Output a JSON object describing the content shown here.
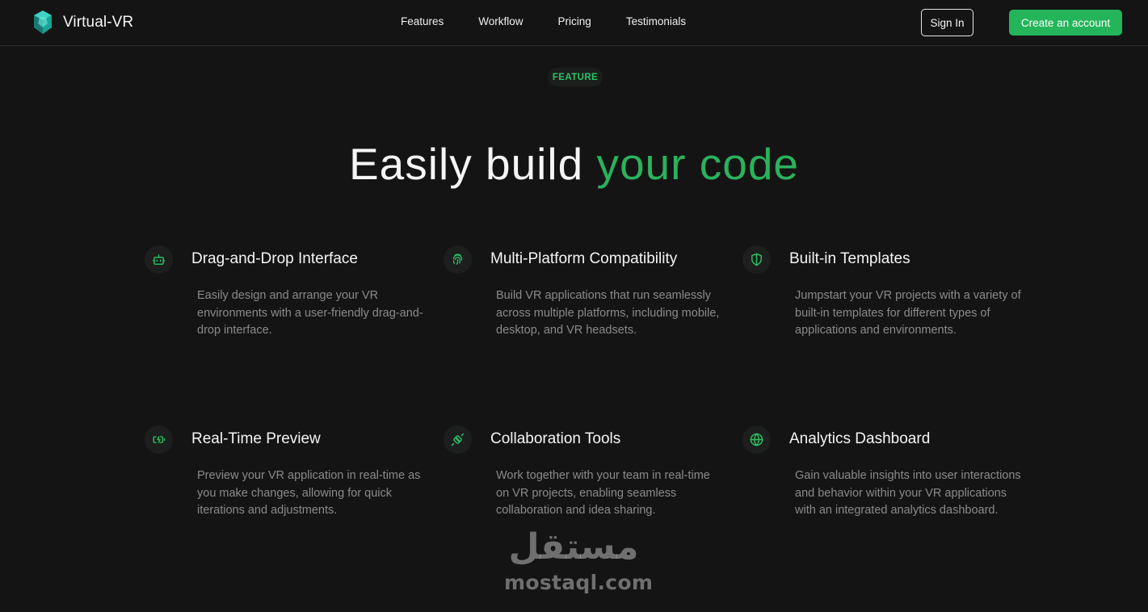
{
  "brand": {
    "name": "Virtual-VR",
    "logo_icon": "vr-gem-logo-icon"
  },
  "nav": {
    "links": [
      "Features",
      "Workflow",
      "Pricing",
      "Testimonials"
    ],
    "sign_in": "Sign In",
    "create_account": "Create an account"
  },
  "hero": {
    "badge": "FEATURE",
    "title_plain": "Easily build ",
    "title_accent": "your code"
  },
  "features": [
    {
      "icon": "bot-icon",
      "title": "Drag-and-Drop Interface",
      "description": "Easily design and arrange your VR environments with a user-friendly drag-and-drop interface."
    },
    {
      "icon": "fingerprint-icon",
      "title": "Multi-Platform Compatibility",
      "description": "Build VR applications that run seamlessly across multiple platforms, including mobile, desktop, and VR headsets."
    },
    {
      "icon": "shield-icon",
      "title": "Built-in Templates",
      "description": "Jumpstart your VR projects with a variety of built-in templates for different types of applications and environments."
    },
    {
      "icon": "battery-charging-icon",
      "title": "Real-Time Preview",
      "description": "Preview your VR application in real-time as you make changes, allowing for quick iterations and adjustments."
    },
    {
      "icon": "plug-icon",
      "title": "Collaboration Tools",
      "description": "Work together with your team in real-time on VR projects, enabling seamless collaboration and idea sharing."
    },
    {
      "icon": "globe-icon",
      "title": "Analytics Dashboard",
      "description": "Gain valuable insights into user interactions and behavior within your VR applications with an integrated analytics dashboard."
    }
  ],
  "watermark": {
    "arabic": "مستقل",
    "latin": "mostaql.com"
  },
  "colors": {
    "background": "#141414",
    "accent_green": "#2bb15c",
    "button_green": "#24b55a",
    "text_muted": "#8a8a8a"
  }
}
